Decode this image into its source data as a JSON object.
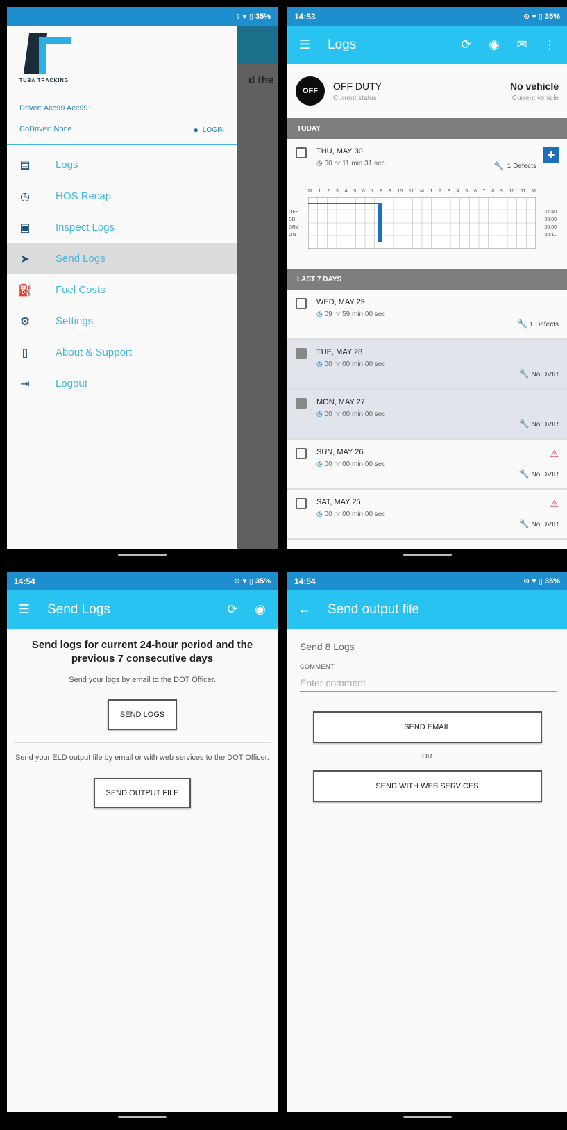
{
  "status_bar": {
    "time_1": "14:53",
    "time_2": "14:54",
    "battery": "35%"
  },
  "drawer": {
    "driver": "Driver: Acc99 Acc991",
    "codriver": "CoDriver: None",
    "login": "LOGIN",
    "logo_text": "TUBA TRACKING",
    "behind_fragment": "d the",
    "items": [
      {
        "label": "Logs",
        "icon": "list-icon"
      },
      {
        "label": "HOS Recap",
        "icon": "clock-icon"
      },
      {
        "label": "Inspect Logs",
        "icon": "inspect-icon"
      },
      {
        "label": "Send Logs",
        "icon": "send-icon"
      },
      {
        "label": "Fuel Costs",
        "icon": "fuel-icon"
      },
      {
        "label": "Settings",
        "icon": "gear-icon"
      },
      {
        "label": "About & Support",
        "icon": "phone-icon"
      },
      {
        "label": "Logout",
        "icon": "logout-icon"
      }
    ]
  },
  "logs": {
    "title": "Logs",
    "status": "OFF DUTY",
    "status_sub": "Current status",
    "badge": "OFF",
    "vehicle": "No vehicle",
    "vehicle_sub": "Current vehicle",
    "today_header": "TODAY",
    "last7_header": "LAST 7 DAYS",
    "today": {
      "date": "THU, MAY 30",
      "time": "00 hr 11 min 31 sec",
      "defects": "1 Defects"
    },
    "hours": [
      "M",
      "1",
      "2",
      "3",
      "4",
      "5",
      "6",
      "7",
      "8",
      "9",
      "10",
      "11",
      "M",
      "1",
      "2",
      "3",
      "4",
      "5",
      "6",
      "7",
      "8",
      "9",
      "10",
      "11",
      "M"
    ],
    "chart_labels": [
      "OFF",
      "SB",
      "DRV",
      "ON"
    ],
    "chart_totals": [
      "07:40",
      "00:00",
      "00:00",
      "00:11"
    ],
    "days": [
      {
        "date": "WED, MAY 29",
        "time": "09 hr 59 min 00 sec",
        "right": "1 Defects",
        "selected": false,
        "warn": false
      },
      {
        "date": "TUE, MAY 28",
        "time": "00 hr 00 min 00 sec",
        "right": "No DVIR",
        "selected": true,
        "warn": false
      },
      {
        "date": "MON, MAY 27",
        "time": "00 hr 00 min 00 sec",
        "right": "No DVIR",
        "selected": true,
        "warn": false
      },
      {
        "date": "SUN, MAY 26",
        "time": "00 hr 00 min 00 sec",
        "right": "No DVIR",
        "selected": false,
        "warn": true
      },
      {
        "date": "SAT, MAY 25",
        "time": "00 hr 00 min 00 sec",
        "right": "No DVIR",
        "selected": false,
        "warn": true
      }
    ]
  },
  "send_logs": {
    "title": "Send Logs",
    "heading": "Send logs for current 24-hour period and the previous 7 consecutive days",
    "sub1": "Send your logs by email to the DOT Officer.",
    "btn1": "SEND LOGS",
    "sub2": "Send your ELD output file by email or with web services to the DOT Officer.",
    "btn2": "SEND OUTPUT FILE"
  },
  "output_file": {
    "title": "Send output file",
    "count": "Send 8 Logs",
    "comment_label": "COMMENT",
    "comment_placeholder": "Enter comment",
    "comment_value": "",
    "btn_email": "SEND EMAIL",
    "or": "OR",
    "btn_ws": "SEND WITH WEB SERVICES"
  },
  "colors": {
    "toolbar": "#29c3f1",
    "status_bar": "#1d8fcf",
    "accent": "#1c6fb8",
    "section": "#7e7e7e"
  }
}
